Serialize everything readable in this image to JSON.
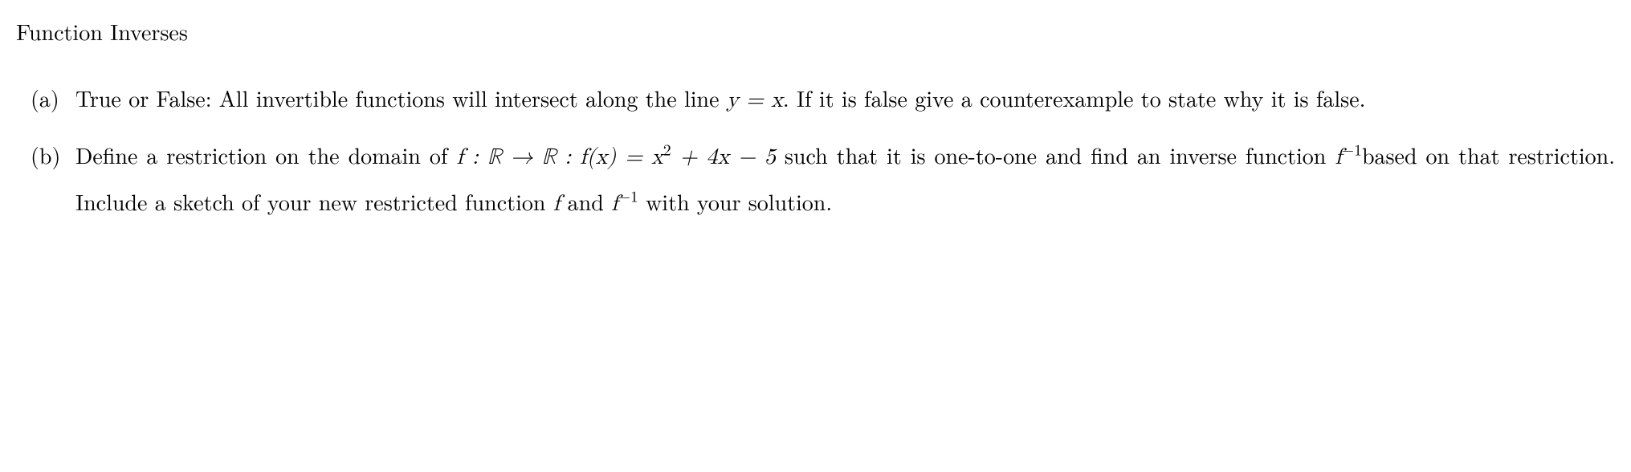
{
  "title": "Function Inverses",
  "items": {
    "a": {
      "label": "(a)",
      "pre": "True or False: All invertible functions will intersect along the line ",
      "eq": "y = x",
      "post": ". If it is false give a counterexample to state why it is false."
    },
    "b": {
      "label": "(b)",
      "pre": "Define a restriction on the domain of ",
      "func_map": "f : ℝ → ℝ : f(x) = x",
      "exp2": "2",
      "plus_4x": " + 4x − 5",
      "mid1": " such that it is one-to-one and find an inverse function ",
      "finv": "f",
      "neg1a": "−1",
      "mid2": "based on that restriction. Include a sketch of your new restricted function ",
      "f": "f",
      "and": " and ",
      "finv2": "f",
      "neg1b": "−1",
      "post": " with your solution."
    }
  }
}
